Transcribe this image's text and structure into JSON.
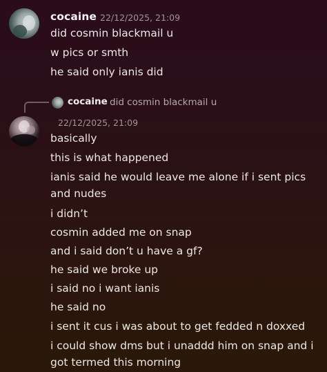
{
  "message1": {
    "author": "cocaine",
    "timestamp": "22/12/2025, 21:09",
    "lines": [
      "did cosmin blackmail u",
      "w pics or smth",
      "he said only ianis did"
    ]
  },
  "reply": {
    "author": "cocaine",
    "text": "did cosmin blackmail u"
  },
  "message2": {
    "timestamp": "22/12/2025, 21:09",
    "lines": [
      "basically",
      "this is what happened",
      "ianis said he would leave me alone if i sent pics",
      "and nudes",
      "i didn’t",
      "cosmin added me on snap",
      "and i said don’t u have a gf?",
      "he said we broke up",
      "i said no i want ianis",
      "he said no",
      "i sent it cus i was about to get fedded n doxxed",
      "i could show dms but i unaddd him on snap and i",
      "got termed this morning"
    ]
  }
}
